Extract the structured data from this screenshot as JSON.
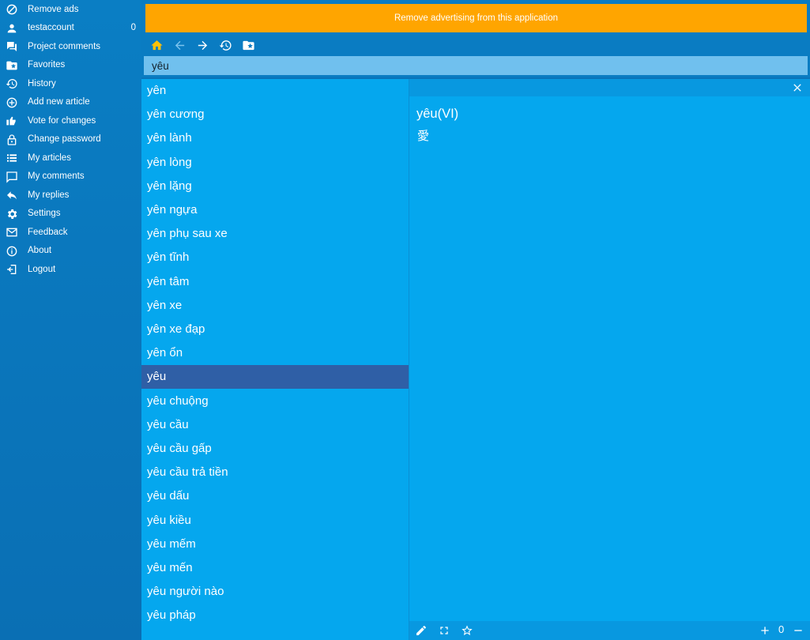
{
  "sidebar": {
    "items": [
      {
        "icon": "block-icon",
        "label": "Remove ads"
      },
      {
        "icon": "person-icon",
        "label": "testaccount",
        "count": "0"
      },
      {
        "icon": "comments-icon",
        "label": "Project comments"
      },
      {
        "icon": "favorites-folder-icon",
        "label": "Favorites"
      },
      {
        "icon": "history-icon",
        "label": "History"
      },
      {
        "icon": "add-circle-icon",
        "label": "Add new article"
      },
      {
        "icon": "vote-icon",
        "label": "Vote for changes"
      },
      {
        "icon": "lock-icon",
        "label": "Change password"
      },
      {
        "icon": "list-icon",
        "label": "My articles"
      },
      {
        "icon": "comment-icon",
        "label": "My comments"
      },
      {
        "icon": "reply-icon",
        "label": "My replies"
      },
      {
        "icon": "gear-icon",
        "label": "Settings"
      },
      {
        "icon": "mail-icon",
        "label": "Feedback"
      },
      {
        "icon": "info-icon",
        "label": "About"
      },
      {
        "icon": "logout-icon",
        "label": "Logout"
      }
    ]
  },
  "ad_banner": {
    "text": "Remove advertising from this application",
    "color": "#ffa500"
  },
  "toolbar": {
    "icons": [
      "home-icon",
      "back-arrow-icon",
      "forward-arrow-icon",
      "history-icon",
      "favorites-folder-icon"
    ],
    "home_color": "#ffc107"
  },
  "search": {
    "value": "yêu"
  },
  "wordlist": {
    "items": [
      "yên",
      "yên cương",
      "yên lành",
      "yên lòng",
      "yên lặng",
      "yên ngựa",
      "yên phụ sau xe",
      "yên tĩnh",
      "yên tâm",
      "yên xe",
      "yên xe đạp",
      "yên ổn",
      "yêu",
      "yêu chuộng",
      "yêu cầu",
      "yêu cầu gấp",
      "yêu cầu trả tiền",
      "yêu dấu",
      "yêu kiều",
      "yêu mếm",
      "yêu mến",
      "yêu người nào",
      "yêu pháp"
    ],
    "selected": "yêu"
  },
  "detail": {
    "title": "yêu(VI)",
    "definition": "愛",
    "count": "0",
    "icons": [
      "close-icon",
      "edit-icon",
      "fullscreen-icon",
      "star-icon",
      "plus-icon",
      "minus-icon"
    ]
  }
}
